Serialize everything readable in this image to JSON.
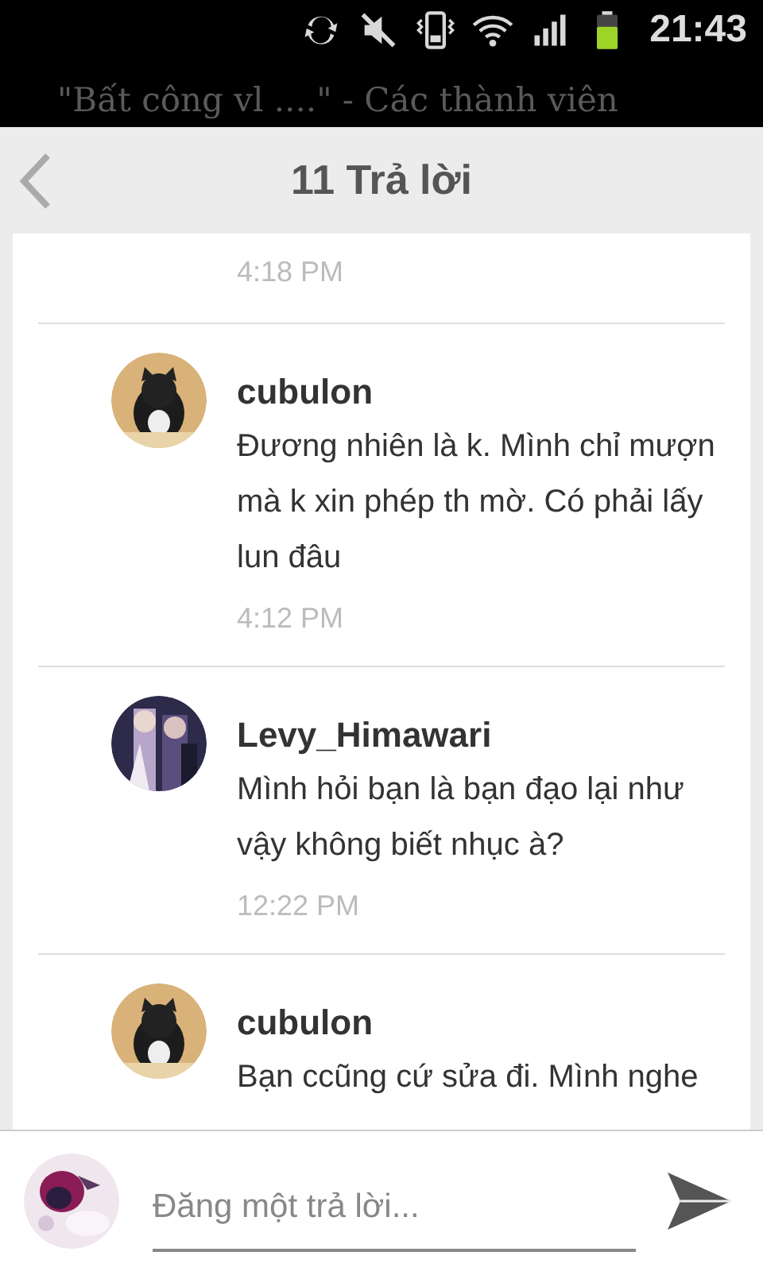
{
  "status_bar": {
    "time": "21:43"
  },
  "background_text": [
    "\"Bất công vl ....\" - Các thành viên"
  ],
  "header": {
    "title": "11 Trả lời"
  },
  "replies": [
    {
      "time": "4:18 PM"
    },
    {
      "author": "cubulon",
      "text": "Đương nhiên là k. Mình chỉ mượn mà k xin phép th mờ. Có phải lấy lun đâu",
      "time": "4:12 PM"
    },
    {
      "author": "Levy_Himawari",
      "text": "Mình hỏi bạn là bạn đạo lại như vậy không biết nhục à?",
      "time": "12:22 PM"
    },
    {
      "author": "cubulon",
      "text": "Bạn ccũng cứ sửa đi. Mình nghe"
    }
  ],
  "composer": {
    "placeholder": "Đăng một trả lời..."
  }
}
